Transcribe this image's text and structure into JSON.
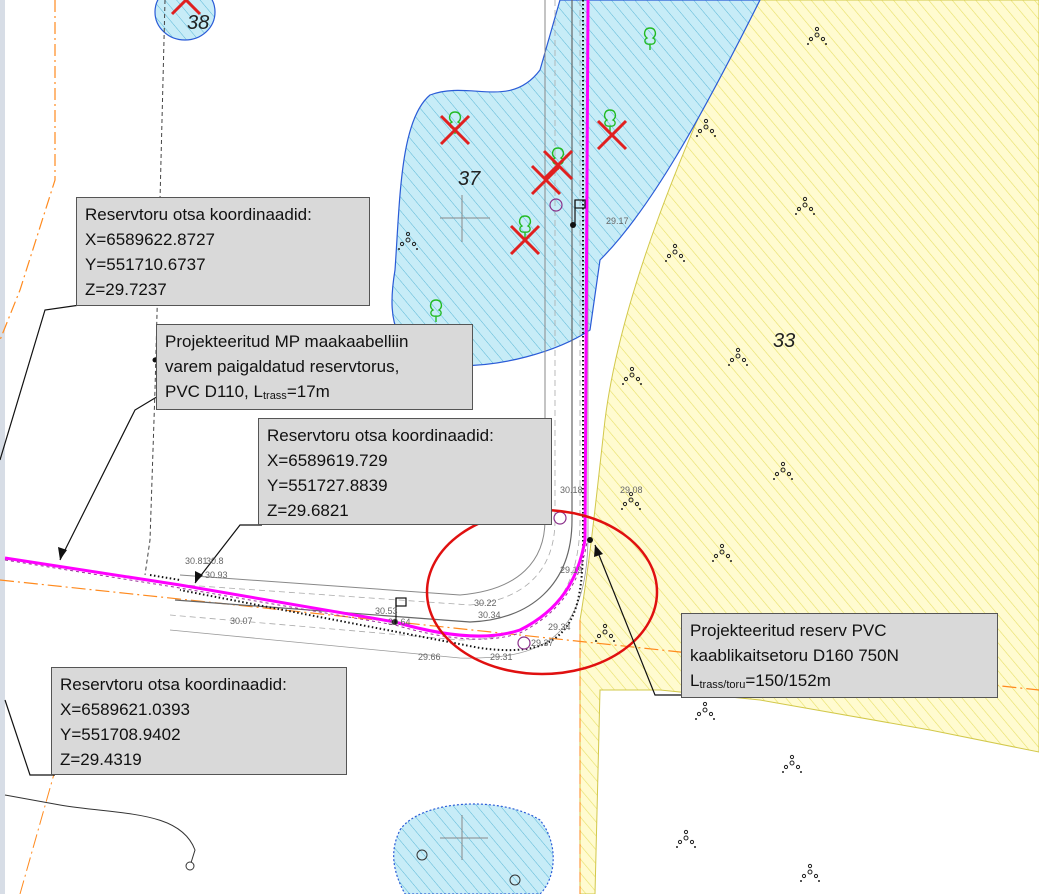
{
  "parcels": [
    {
      "id": "38",
      "label": "38"
    },
    {
      "id": "37",
      "label": "37"
    },
    {
      "id": "33",
      "label": "33"
    }
  ],
  "callouts": {
    "coords_top": {
      "title": "Reservtoru otsa koordinaadid:",
      "x": "X=6589622.8727",
      "y": "Y=551710.6737",
      "z": "Z=29.7237"
    },
    "coords_middle": {
      "title": "Reservtoru otsa koordinaadid:",
      "x": "X=6589619.729",
      "y": "Y=551727.8839",
      "z": "Z=29.6821"
    },
    "coords_bottom": {
      "title": "Reservtoru otsa koordinaadid:",
      "x": "X=6589621.0393",
      "y": "Y=551708.9402",
      "z": "Z=29.4319"
    },
    "cable": {
      "line1": "Projekteeritud MP maakaabelliin",
      "line2": "varem paigaldatud reservtorus,",
      "line3_prefix": "PVC D110, L",
      "line3_sub": "trass",
      "line3_suffix": "=17m"
    },
    "reserve_pipe": {
      "line1": "Projekteeritud reserv PVC",
      "line2": "kaablikaitsetoru D160 750N",
      "line3_prefix": "L",
      "line3_sub": "trass/toru",
      "line3_suffix": "=150/152m"
    }
  },
  "elevations": {
    "e1": "30.81",
    "e2": "30.93",
    "e3": "30.8",
    "e4": "30.07",
    "e5": "30.53",
    "e6": "30.64",
    "e7": "29.66",
    "e8": "30.22",
    "e9": "30.34",
    "e10": "29.19",
    "e11": "29.34",
    "e12": "29.37",
    "e13": "29.31",
    "e14": "29.08",
    "e15": "29.17",
    "e16": "30.18"
  },
  "colors": {
    "forest_fill": "#c7ecf7",
    "forest_hatch": "#5ab7d6",
    "field_fill": "#fffbd0",
    "field_hatch": "#e8e066",
    "cable": "#ff00ff",
    "highlight_circle": "#e01010",
    "road": "#777777",
    "boundary": "#ff8a1e",
    "callout_bg": "#d9d9d9"
  },
  "icons": [
    "tree-icon",
    "removed-tree-cross-icon",
    "shrub-dot-cluster-icon",
    "manhole-icon",
    "sign-post-icon"
  ]
}
